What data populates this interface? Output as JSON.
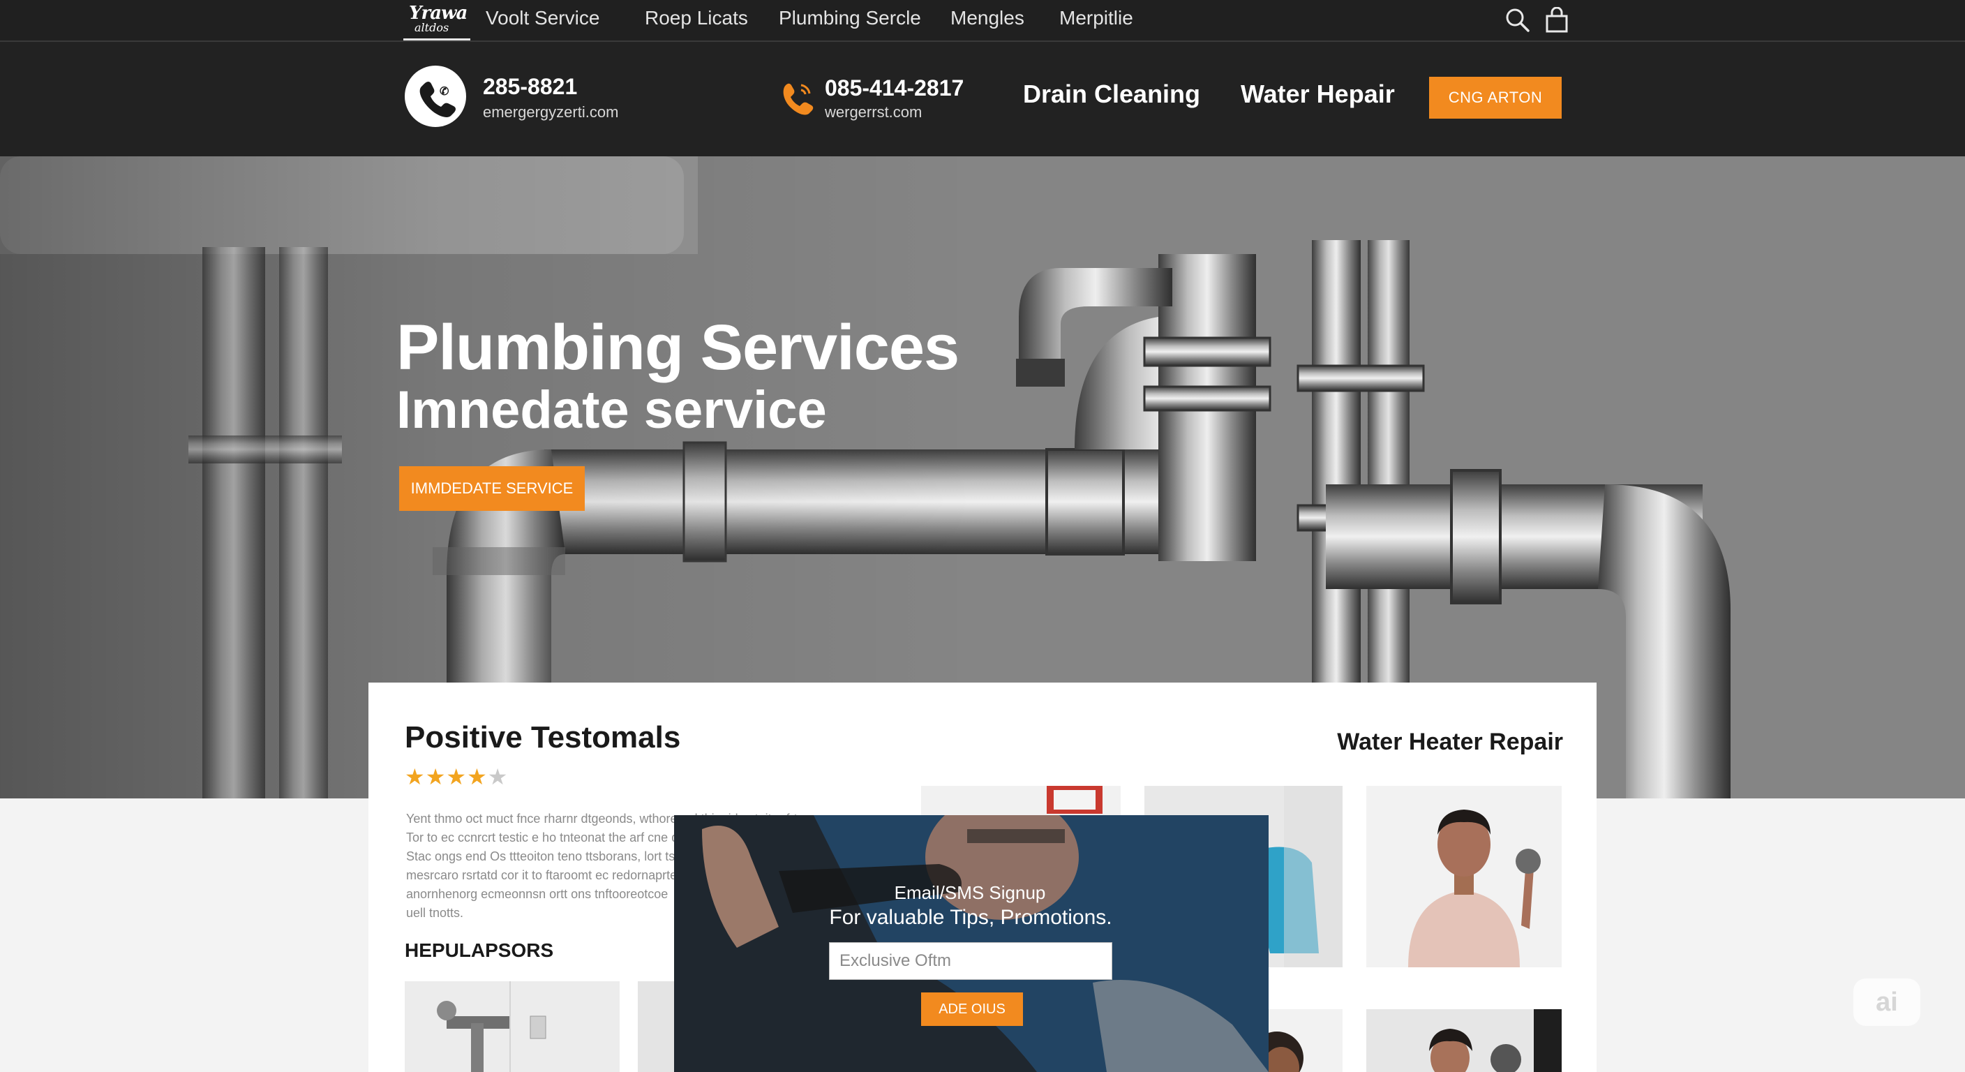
{
  "brand": {
    "logo_top": "Yrawa",
    "logo_bottom": "altdos"
  },
  "nav": {
    "links": [
      "Voolt Service",
      "Roep Licats",
      "Plumbing Sercle",
      "Mengles",
      "Merpitlie"
    ],
    "icons": [
      "search-icon",
      "bag-icon"
    ]
  },
  "contact": {
    "primary_phone": "285-8821",
    "primary_email": "emergergyzerti.com",
    "secondary_phone": "085-414-2817",
    "secondary_email": "wergerrst.com",
    "links": [
      "Drain Cleaning",
      "Water Hepair"
    ],
    "cta_label": "CNG ARTON"
  },
  "hero": {
    "title": "Plumbing Services",
    "subtitle": "Imnedate service",
    "button_label": "IMMDEDATE SERVICE",
    "slide_count": 5,
    "active_slide": 1
  },
  "testimonials": {
    "title": "Positive Testomals",
    "rating": 4,
    "rating_max": 5,
    "text_lines": [
      "Yent thmo oct muct fnce rharnr dtgeonds, wthoreon l thinuid ovtuite rfrtne.",
      "Tor to ec ccnrcrt testic e ho tnteonat the arf cne dtiobr ovitaphar",
      "Stac ongs end Os ttteoiton teno ttsborans, lort tsj",
      "mesrcaro rsrtatd cor it to ftaroomt ec redornaprte",
      "anornhenorg ecmeonnsn ortt ons tnftooreotcoe",
      "uell tnotts."
    ],
    "help_title": "HEPULAPSORS"
  },
  "water_heater": {
    "title": "Water Heater Repair"
  },
  "signup": {
    "title": "Email/SMS Signup",
    "subtitle": "For valuable Tips, Promotions.",
    "placeholder": "Exclusive Oftm",
    "button_label": "ADE OIUS"
  },
  "badge": {
    "label": "ai"
  },
  "colors": {
    "accent": "#f28a1f",
    "topbar": "#202020",
    "contactbar": "#222222",
    "panel": "#ffffff",
    "star": "#f2a41f"
  }
}
